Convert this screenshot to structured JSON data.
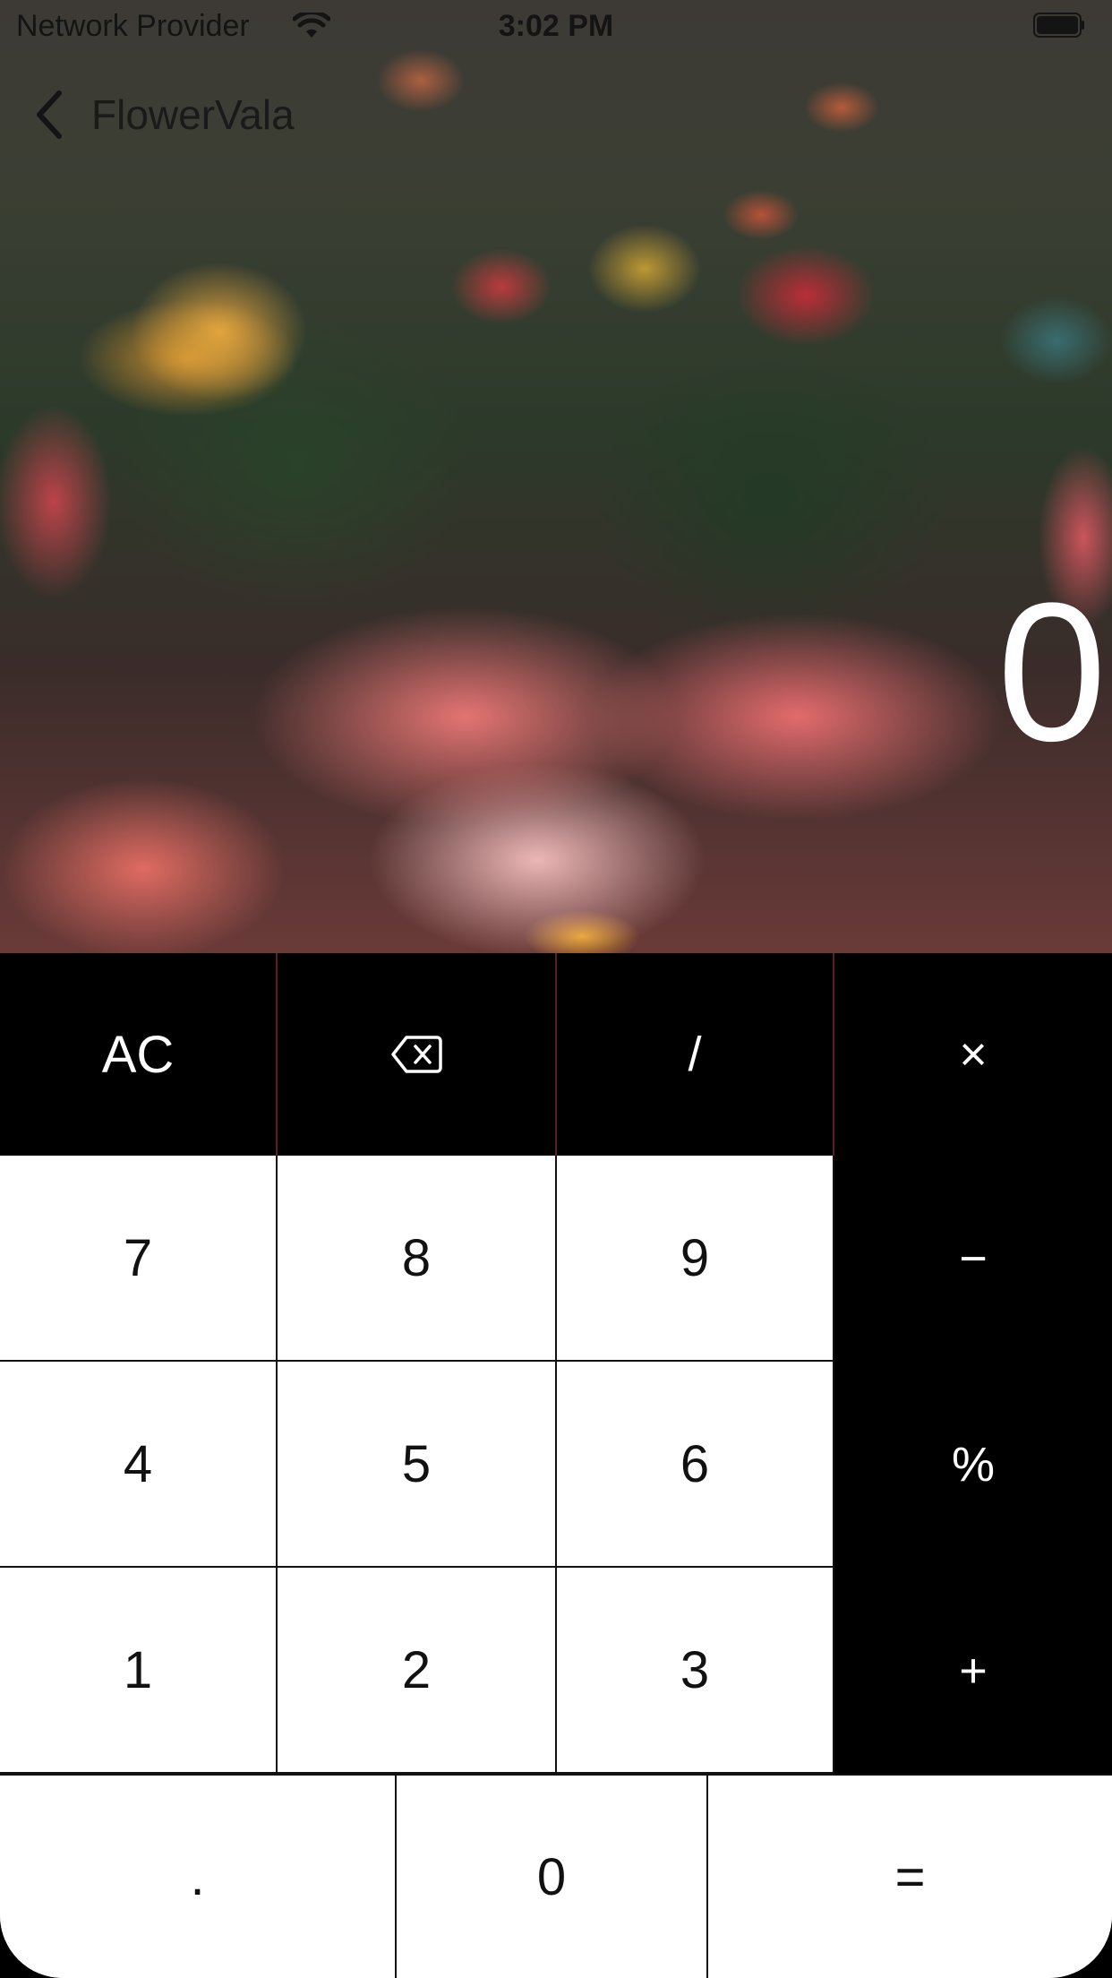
{
  "status_bar": {
    "carrier": "Network Provider",
    "time": "3:02 PM",
    "wifi_icon": "wifi-icon",
    "battery_icon": "battery-icon"
  },
  "nav": {
    "back_icon": "chevron-left-icon",
    "title": "FlowerVala"
  },
  "display": {
    "value": "0"
  },
  "keypad": {
    "row1": [
      "AC",
      "backspace",
      "/",
      "×"
    ],
    "row2": [
      "7",
      "8",
      "9",
      "−"
    ],
    "row3": [
      "4",
      "5",
      "6",
      "%"
    ],
    "row4": [
      "1",
      "2",
      "3",
      "+"
    ],
    "row5": [
      ".",
      "0",
      "="
    ],
    "labels": {
      "ac": "AC",
      "divide": "/",
      "multiply": "×",
      "minus": "−",
      "percent": "%",
      "plus": "+",
      "dot": ".",
      "equals": "=",
      "d0": "0",
      "d1": "1",
      "d2": "2",
      "d3": "3",
      "d4": "4",
      "d5": "5",
      "d6": "6",
      "d7": "7",
      "d8": "8",
      "d9": "9"
    },
    "backspace_icon": "backspace-icon"
  },
  "colors": {
    "key_dark": "#000000",
    "key_light": "#ffffff",
    "display_text": "#ffffff"
  }
}
